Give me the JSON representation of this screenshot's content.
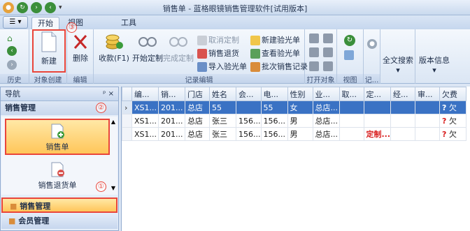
{
  "window": {
    "title": "销售单 - 蓝格眼镜销售管理软件[试用版本]"
  },
  "tabs": [
    {
      "label": "开始"
    },
    {
      "label": "视图"
    },
    {
      "label": "工具"
    }
  ],
  "ribbon": {
    "history_label": "历史",
    "object_create_label": "对象创建",
    "new_label": "新建",
    "edit_label": "编辑",
    "delete_label": "删除",
    "record_edit_label": "记录编辑",
    "collect_label": "收款(F1)",
    "start_custom_label": "开始定制",
    "finish_custom_label": "完成定制",
    "cancel_custom_label": "取消定制",
    "sales_return_label": "销售退货",
    "import_light_label": "导入验光单",
    "new_light_label": "新建验光单",
    "view_light_label": "查看验光单",
    "batch_record_label": "批次销售记录",
    "open_object_label": "打开对象",
    "view_group_label": "视图",
    "records_label": "记...",
    "search_label": "全文搜索",
    "version_label": "版本信息"
  },
  "nav": {
    "title": "导航",
    "pin": "ᵖ",
    "close": "×",
    "section": "销售管理",
    "items": [
      {
        "label": "销售单"
      },
      {
        "label": "销售退货单"
      }
    ],
    "bottom_sales": "销售管理",
    "bottom_members": "会员管理"
  },
  "annotations": {
    "one": "①",
    "two": "②",
    "three": "③"
  },
  "table": {
    "columns": [
      "编...",
      "销...",
      "门店",
      "姓名",
      "会...",
      "电...",
      "性别",
      "业...",
      "取...",
      "定...",
      "经...",
      "审...",
      "欠费"
    ],
    "rows": [
      [
        "XS1...",
        "201...",
        "总店",
        "55",
        "",
        "55",
        "女",
        "总店...",
        "",
        "",
        "",
        "",
        "欠"
      ],
      [
        "XS1...",
        "201...",
        "总店",
        "张三",
        "156...",
        "156...",
        "男",
        "总店...",
        "",
        "",
        "",
        "",
        "欠"
      ],
      [
        "XS1...",
        "201...",
        "总店",
        "张三",
        "156...",
        "156...",
        "男",
        "总店...",
        "",
        "定制...",
        "",
        "",
        "欠"
      ]
    ]
  }
}
